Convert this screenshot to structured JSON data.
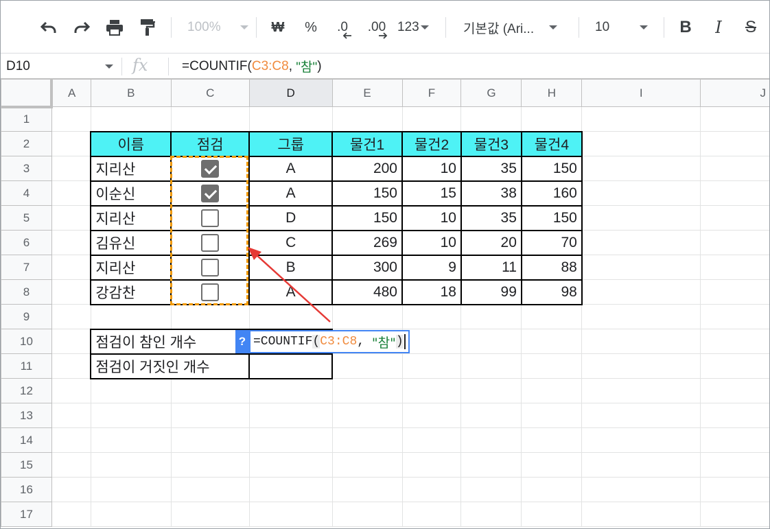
{
  "toolbar": {
    "zoom": "100%",
    "currency_label": "₩",
    "percent_label": "%",
    "decrease_decimal_label": ".0",
    "increase_decimal_label": ".00",
    "more_formats_label": "123",
    "font_family": "기본값 (Ari...",
    "font_size": "10",
    "bold_label": "B",
    "italic_label": "I",
    "strike_label": "S"
  },
  "formula_bar": {
    "cell_ref": "D10",
    "fx_label": "fx",
    "formula": {
      "prefix": "=COUNTIF(",
      "range": "C3:C8",
      "sep": ", ",
      "criterion": "\"참\"",
      "suffix": ")"
    }
  },
  "columns": [
    "A",
    "B",
    "C",
    "D",
    "E",
    "F",
    "G",
    "H",
    "I",
    "J"
  ],
  "rows": [
    "1",
    "2",
    "3",
    "4",
    "5",
    "6",
    "7",
    "8",
    "9",
    "10",
    "11",
    "12",
    "13",
    "14",
    "15",
    "16",
    "17"
  ],
  "selected_column": "D",
  "table": {
    "headers": [
      "이름",
      "점검",
      "그룹",
      "물건1",
      "물건2",
      "물건3",
      "물건4"
    ],
    "records": [
      {
        "name": "지리산",
        "checked": true,
        "group": "A",
        "v1": "200",
        "v2": "10",
        "v3": "35",
        "v4": "150"
      },
      {
        "name": "이순신",
        "checked": true,
        "group": "A",
        "v1": "150",
        "v2": "15",
        "v3": "38",
        "v4": "160"
      },
      {
        "name": "지리산",
        "checked": false,
        "group": "D",
        "v1": "150",
        "v2": "10",
        "v3": "35",
        "v4": "150"
      },
      {
        "name": "김유신",
        "checked": false,
        "group": "C",
        "v1": "269",
        "v2": "10",
        "v3": "20",
        "v4": "70"
      },
      {
        "name": "지리산",
        "checked": false,
        "group": "B",
        "v1": "300",
        "v2": "9",
        "v3": "11",
        "v4": "88"
      },
      {
        "name": "강감찬",
        "checked": false,
        "group": "A",
        "v1": "480",
        "v2": "18",
        "v3": "99",
        "v4": "98"
      }
    ]
  },
  "summary": {
    "true_label": "점검이 참인 개수",
    "false_label": "점검이 거짓인 개수"
  },
  "editor": {
    "help_label": "?",
    "prefix": "=COUNTIF",
    "open": "(",
    "range": "C3:C8",
    "sep": ", ",
    "criterion": "\"참\"",
    "close": ")"
  },
  "colors": {
    "header_fill": "#4ef2f5",
    "dash_border": "#f29900",
    "arrow": "#e53935",
    "editor_border": "#4285f4",
    "range_ref": "#f08b3e",
    "string_literal": "#188038"
  }
}
